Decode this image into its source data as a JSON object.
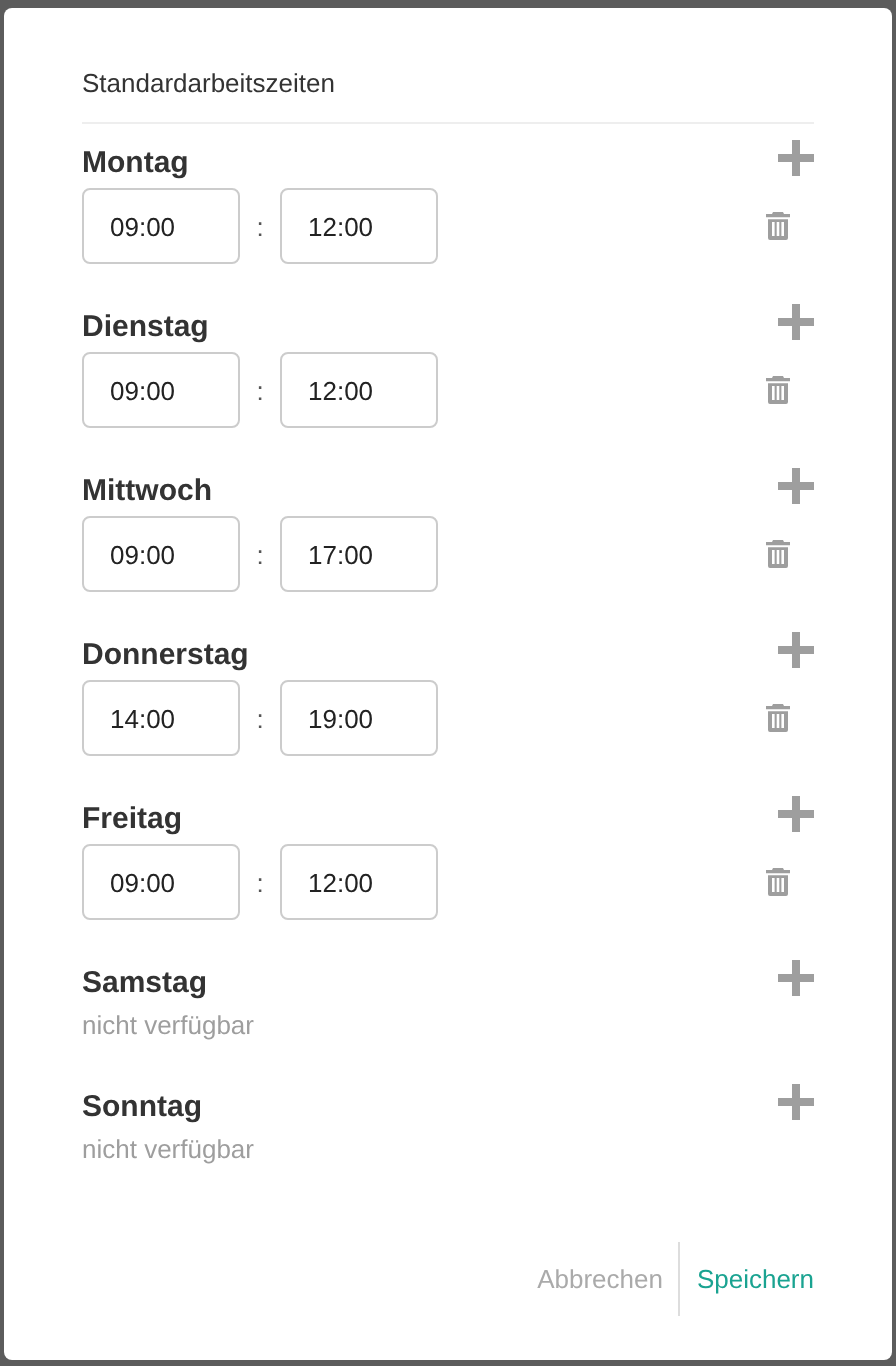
{
  "dialog": {
    "title": "Standardarbeitszeiten",
    "days": [
      {
        "name": "Montag",
        "kind": "slots",
        "slots": [
          {
            "start": "09:00",
            "separator": ":",
            "end": "12:00"
          }
        ]
      },
      {
        "name": "Dienstag",
        "kind": "slots",
        "slots": [
          {
            "start": "09:00",
            "separator": ":",
            "end": "12:00"
          }
        ]
      },
      {
        "name": "Mittwoch",
        "kind": "slots",
        "slots": [
          {
            "start": "09:00",
            "separator": ":",
            "end": "17:00"
          }
        ]
      },
      {
        "name": "Donnerstag",
        "kind": "slots",
        "slots": [
          {
            "start": "14:00",
            "separator": ":",
            "end": "19:00"
          }
        ]
      },
      {
        "name": "Freitag",
        "kind": "slots",
        "slots": [
          {
            "start": "09:00",
            "separator": ":",
            "end": "12:00"
          }
        ]
      },
      {
        "name": "Samstag",
        "kind": "unavailable",
        "note": "nicht verfügbar"
      },
      {
        "name": "Sonntag",
        "kind": "unavailable",
        "note": "nicht verfügbar"
      }
    ],
    "buttons": [
      {
        "label": "Abbrechen",
        "primary": false
      },
      {
        "label": "Speichern",
        "primary": true
      }
    ]
  }
}
